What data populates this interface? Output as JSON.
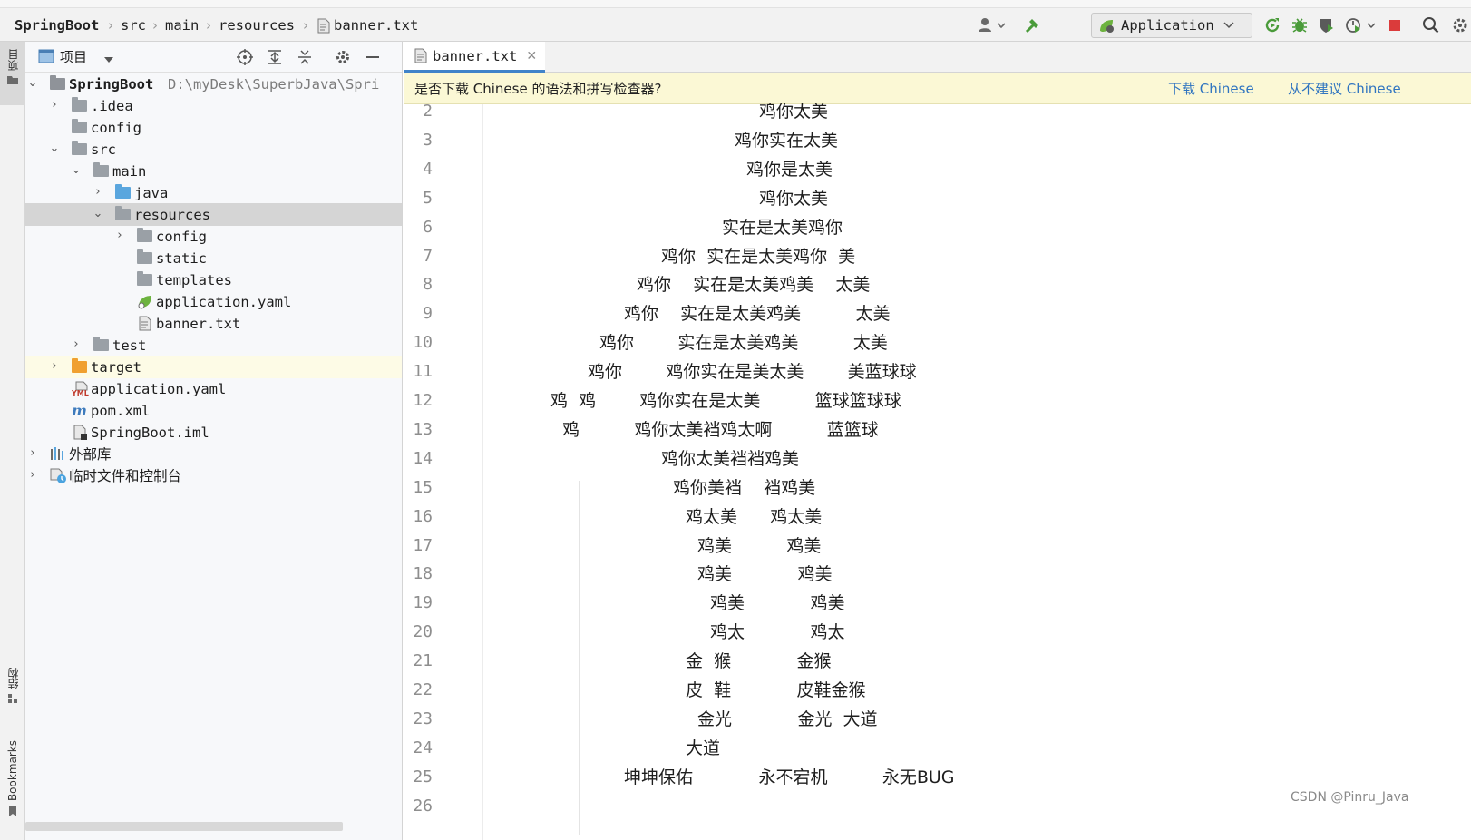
{
  "navbar": {
    "breadcrumbs": [
      "SpringBoot",
      "src",
      "main",
      "resources",
      "banner.txt"
    ],
    "run_config": "Application"
  },
  "left_stripe": {
    "project_label": "项目",
    "structure_label": "结构",
    "bookmarks_label": "Bookmarks"
  },
  "project_panel": {
    "title": "项目",
    "tree": [
      {
        "label": "SpringBoot",
        "path": "D:\\myDesk\\SuperbJava\\Spri"
      },
      {
        "label": ".idea"
      },
      {
        "label": "config"
      },
      {
        "label": "src"
      },
      {
        "label": "main"
      },
      {
        "label": "java"
      },
      {
        "label": "resources"
      },
      {
        "label": "config"
      },
      {
        "label": "static"
      },
      {
        "label": "templates"
      },
      {
        "label": "application.yaml"
      },
      {
        "label": "banner.txt"
      },
      {
        "label": "test"
      },
      {
        "label": "target"
      },
      {
        "label": "application.yaml"
      },
      {
        "label": "pom.xml"
      },
      {
        "label": "SpringBoot.iml"
      },
      {
        "label": "外部库"
      },
      {
        "label": "临时文件和控制台"
      }
    ]
  },
  "editor": {
    "tab_label": "banner.txt",
    "notification": {
      "question": "是否下载 Chinese 的语法和拼写检查器?",
      "download": "下载 Chinese",
      "not_recommend": "从不建议 Chinese"
    },
    "lines": [
      {
        "n": "2",
        "t": "鸡你太美"
      },
      {
        "n": "3",
        "t": "鸡你实在太美"
      },
      {
        "n": "4",
        "t": "鸡你是太美"
      },
      {
        "n": "5",
        "t": "鸡你太美"
      },
      {
        "n": "6",
        "t": "实在是太美鸡你"
      },
      {
        "n": "7",
        "t": "鸡你  实在是太美鸡你  美"
      },
      {
        "n": "8",
        "t": "鸡你    实在是太美鸡美    太美"
      },
      {
        "n": "9",
        "t": "鸡你    实在是太美鸡美          太美"
      },
      {
        "n": "10",
        "t": "鸡你        实在是太美鸡美          太美"
      },
      {
        "n": "11",
        "t": "鸡你        鸡你实在是美太美        美蓝球球"
      },
      {
        "n": "12",
        "t": "鸡  鸡        鸡你实在是太美          篮球篮球球"
      },
      {
        "n": "13",
        "t": "鸡          鸡你太美裆鸡太啊          蓝篮球"
      },
      {
        "n": "14",
        "t": "鸡你太美裆裆鸡美"
      },
      {
        "n": "15",
        "t": "鸡你美裆    裆鸡美"
      },
      {
        "n": "16",
        "t": "鸡太美      鸡太美"
      },
      {
        "n": "17",
        "t": "鸡美          鸡美"
      },
      {
        "n": "18",
        "t": "鸡美            鸡美"
      },
      {
        "n": "19",
        "t": "鸡美            鸡美"
      },
      {
        "n": "20",
        "t": "鸡太            鸡太"
      },
      {
        "n": "21",
        "t": "金  猴            金猴"
      },
      {
        "n": "22",
        "t": "皮  鞋            皮鞋金猴"
      },
      {
        "n": "23",
        "t": "金光            金光  大道"
      },
      {
        "n": "24",
        "t": "大道"
      },
      {
        "n": "25",
        "t": "坤坤保佑            永不宕机          永无BUG"
      },
      {
        "n": "26",
        "t": ""
      }
    ]
  },
  "watermark": "CSDN @Pinru_Java"
}
